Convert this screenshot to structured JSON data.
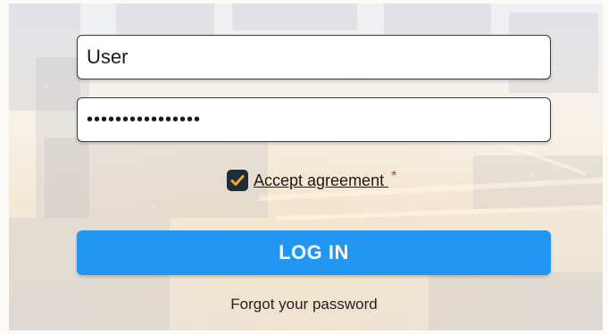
{
  "login_form": {
    "username_value": "User",
    "password_value": "••••••••••••••••",
    "accept_label": "Accept agreement ",
    "accept_checked": true,
    "required_marker": "*",
    "login_button_label": "LOG IN",
    "forgot_password_label": "Forgot your password"
  },
  "colors": {
    "button_blue": "#2196f3",
    "checkbox_dark": "#1f2d3a",
    "check_orange": "#f5a623",
    "required_red": "#e0322f"
  },
  "icons": {
    "checkbox": "checkmark-icon"
  }
}
